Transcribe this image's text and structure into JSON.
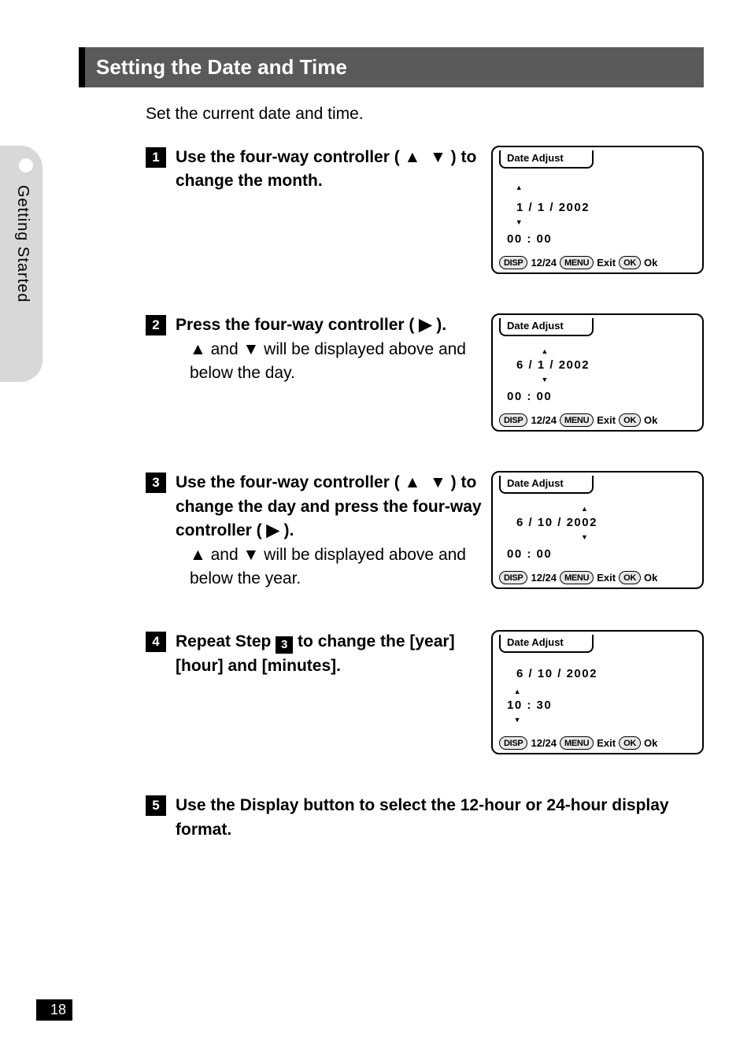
{
  "pageNumber": "18",
  "sideTab": {
    "label": "Getting Started"
  },
  "heading": "Setting the Date and Time",
  "intro": "Set the current date and time.",
  "steps": {
    "s1": {
      "num": "1",
      "title_a": "Use the four-way controller ( ",
      "title_b": " ) to change the month.",
      "lcd": {
        "title": "Date Adjust",
        "date_month": "1",
        "date_sep1": " /   ",
        "date_day": "1",
        "date_sep2": " / ",
        "date_year": "2002",
        "time": "00 : 00",
        "editField": "month"
      }
    },
    "s2": {
      "num": "2",
      "title_a": "Press the four-way controller ( ",
      "title_b": " ).",
      "desc_a": " and ",
      "desc_b": " will be displayed above and below the day.",
      "lcd": {
        "title": "Date Adjust",
        "date_month": "6",
        "date_sep1": " /   ",
        "date_day": "1",
        "date_sep2": " / ",
        "date_year": "2002",
        "time": "00 : 00",
        "editField": "day"
      }
    },
    "s3": {
      "num": "3",
      "title_a": "Use the four-way controller ( ",
      "title_b": " ) to change the day and press the four-way controller ( ",
      "title_c": " ).",
      "desc_a": " and ",
      "desc_b": " will be displayed above and below the year.",
      "lcd": {
        "title": "Date Adjust",
        "date_month": "6",
        "date_sep1": " / ",
        "date_day": "10",
        "date_sep2": " / ",
        "date_year": "2002",
        "time": "00 : 00",
        "editField": "year"
      }
    },
    "s4": {
      "num": "4",
      "title_a": "Repeat Step ",
      "title_ref": "3",
      "title_b": " to change the [year] [hour] and [minutes].",
      "lcd": {
        "title": "Date Adjust",
        "date_month": "6",
        "date_sep1": " / ",
        "date_day": "10",
        "date_sep2": " / ",
        "date_year": "2002",
        "time": "10 : 30",
        "editField": "time"
      }
    },
    "s5": {
      "num": "5",
      "title": "Use the Display button to select the 12-hour or 24-hour display format."
    }
  },
  "lcdFooter": {
    "disp": "DISP",
    "twelve24": "12/24",
    "menu": "MENU",
    "exit": "Exit",
    "okBtn": "OK",
    "ok": "Ok"
  },
  "glyphs": {
    "triUp": "▲",
    "triDown": "▼",
    "triRight": "▶"
  }
}
